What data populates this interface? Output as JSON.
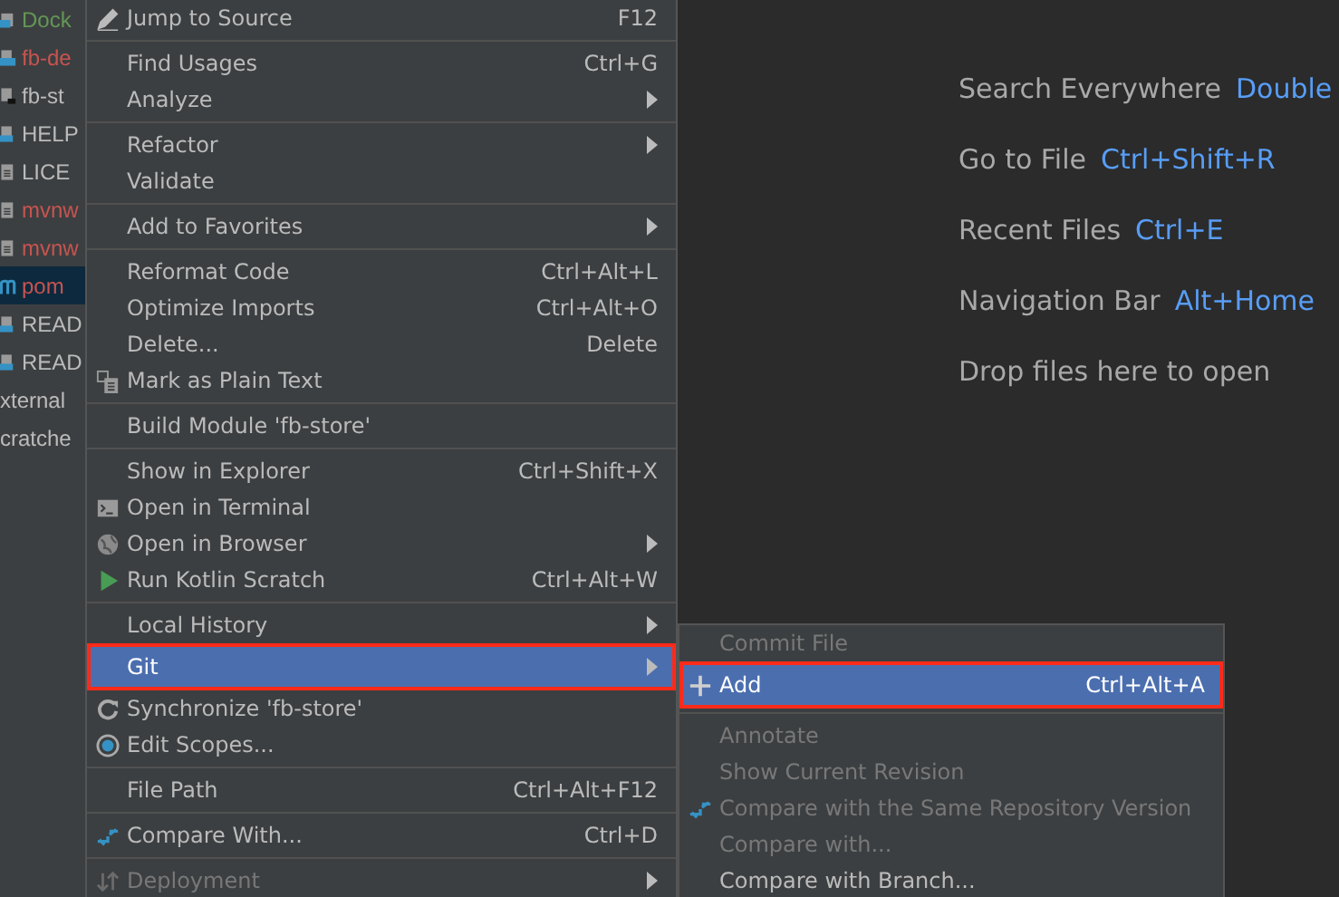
{
  "project_tree": {
    "items": [
      {
        "label": "Dock",
        "color": "#629755",
        "selected": false
      },
      {
        "label": "fb-de",
        "color": "#c75450",
        "selected": false
      },
      {
        "label": "fb-st",
        "color": "#bbbbbb",
        "selected": false
      },
      {
        "label": "HELP",
        "color": "#bbbbbb",
        "selected": false
      },
      {
        "label": "LICE",
        "color": "#bbbbbb",
        "selected": false
      },
      {
        "label": "mvnw",
        "color": "#c75450",
        "selected": false
      },
      {
        "label": "mvnw",
        "color": "#c75450",
        "selected": false
      },
      {
        "label": "pom",
        "color": "#c75450",
        "selected": true
      },
      {
        "label": "READ",
        "color": "#bbbbbb",
        "selected": false
      },
      {
        "label": "READ",
        "color": "#bbbbbb",
        "selected": false
      },
      {
        "label": "xternal",
        "color": "#bbbbbb",
        "selected": false
      },
      {
        "label": "cratche",
        "color": "#bbbbbb",
        "selected": false
      }
    ]
  },
  "context_menu": {
    "items": [
      {
        "kind": "item",
        "label": "Jump to Source",
        "shortcut": "F12",
        "submenu": false,
        "disabled": false,
        "selected": false,
        "highlighted": false
      },
      {
        "kind": "separator"
      },
      {
        "kind": "item",
        "label": "Find Usages",
        "shortcut": "Ctrl+G",
        "submenu": false,
        "disabled": false,
        "selected": false,
        "highlighted": false
      },
      {
        "kind": "item",
        "label": "Analyze",
        "submenu": true,
        "disabled": false,
        "selected": false,
        "highlighted": false
      },
      {
        "kind": "separator"
      },
      {
        "kind": "item",
        "label": "Refactor",
        "submenu": true,
        "disabled": false,
        "selected": false,
        "highlighted": false
      },
      {
        "kind": "item",
        "label": "Validate",
        "submenu": false,
        "disabled": false,
        "selected": false,
        "highlighted": false
      },
      {
        "kind": "separator"
      },
      {
        "kind": "item",
        "label": "Add to Favorites",
        "submenu": true,
        "disabled": false,
        "selected": false,
        "highlighted": false
      },
      {
        "kind": "separator"
      },
      {
        "kind": "item",
        "label": "Reformat Code",
        "shortcut": "Ctrl+Alt+L",
        "submenu": false,
        "disabled": false,
        "selected": false,
        "highlighted": false
      },
      {
        "kind": "item",
        "label": "Optimize Imports",
        "shortcut": "Ctrl+Alt+O",
        "submenu": false,
        "disabled": false,
        "selected": false,
        "highlighted": false
      },
      {
        "kind": "item",
        "label": "Delete...",
        "shortcut": "Delete",
        "submenu": false,
        "disabled": false,
        "selected": false,
        "highlighted": false
      },
      {
        "kind": "item",
        "label": "Mark as Plain Text",
        "submenu": false,
        "disabled": false,
        "selected": false,
        "highlighted": false
      },
      {
        "kind": "separator"
      },
      {
        "kind": "item",
        "label": "Build Module 'fb-store'",
        "submenu": false,
        "disabled": false,
        "selected": false,
        "highlighted": false
      },
      {
        "kind": "separator"
      },
      {
        "kind": "item",
        "label": "Show in Explorer",
        "shortcut": "Ctrl+Shift+X",
        "submenu": false,
        "disabled": false,
        "selected": false,
        "highlighted": false
      },
      {
        "kind": "item",
        "label": "Open in Terminal",
        "submenu": false,
        "disabled": false,
        "selected": false,
        "highlighted": false
      },
      {
        "kind": "item",
        "label": "Open in Browser",
        "submenu": true,
        "disabled": false,
        "selected": false,
        "highlighted": false
      },
      {
        "kind": "item",
        "label": "Run Kotlin Scratch",
        "shortcut": "Ctrl+Alt+W",
        "submenu": false,
        "disabled": false,
        "selected": false,
        "highlighted": false
      },
      {
        "kind": "separator"
      },
      {
        "kind": "item",
        "label": "Local History",
        "submenu": true,
        "disabled": false,
        "selected": false,
        "highlighted": false
      },
      {
        "kind": "item",
        "label": "Git",
        "submenu": true,
        "disabled": false,
        "selected": true,
        "highlighted": true
      },
      {
        "kind": "item",
        "label": "Synchronize 'fb-store'",
        "submenu": false,
        "disabled": false,
        "selected": false,
        "highlighted": false
      },
      {
        "kind": "item",
        "label": "Edit Scopes...",
        "submenu": false,
        "disabled": false,
        "selected": false,
        "highlighted": false
      },
      {
        "kind": "separator"
      },
      {
        "kind": "item",
        "label": "File Path",
        "shortcut": "Ctrl+Alt+F12",
        "submenu": false,
        "disabled": false,
        "selected": false,
        "highlighted": false
      },
      {
        "kind": "separator"
      },
      {
        "kind": "item",
        "label": "Compare With...",
        "shortcut": "Ctrl+D",
        "submenu": false,
        "disabled": false,
        "selected": false,
        "highlighted": false
      },
      {
        "kind": "separator"
      },
      {
        "kind": "item",
        "label": "Deployment",
        "submenu": true,
        "disabled": true,
        "selected": false,
        "highlighted": false
      }
    ]
  },
  "git_submenu": {
    "items": [
      {
        "label": "Commit File",
        "disabled": true,
        "selected": false,
        "highlighted": false
      },
      {
        "label": "Add",
        "shortcut": "Ctrl+Alt+A",
        "disabled": false,
        "selected": true,
        "highlighted": true
      },
      {
        "label": "Annotate",
        "disabled": true,
        "selected": false,
        "highlighted": false
      },
      {
        "label": "Show Current Revision",
        "disabled": true,
        "selected": false,
        "highlighted": false
      },
      {
        "label": "Compare with the Same Repository Version",
        "disabled": true,
        "selected": false,
        "highlighted": false
      },
      {
        "label": "Compare with...",
        "disabled": true,
        "selected": false,
        "highlighted": false
      },
      {
        "label": "Compare with Branch...",
        "disabled": false,
        "selected": false,
        "highlighted": false
      }
    ]
  },
  "editor_hints": [
    {
      "label": "Search Everywhere",
      "shortcut": "Double"
    },
    {
      "label": "Go to File",
      "shortcut": "Ctrl+Shift+R"
    },
    {
      "label": "Recent Files",
      "shortcut": "Ctrl+E"
    },
    {
      "label": "Navigation Bar",
      "shortcut": "Alt+Home"
    },
    {
      "label": "Drop files here to open"
    }
  ]
}
